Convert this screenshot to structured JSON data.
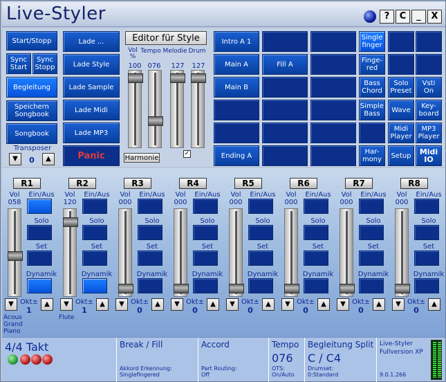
{
  "app": {
    "title": "Live-Styler"
  },
  "window": {
    "help": "?",
    "compact": "C",
    "minimize": "_",
    "close": "X"
  },
  "left_col": {
    "start": "Start/Stopp",
    "sync_start": "Sync Start",
    "sync_stop": "Sync Stopp",
    "begleitung": "Begleitung",
    "speichern": "Speichern Songbook",
    "songbook": "Songbook",
    "transposer_label": "Transposer",
    "transposer_value": "0"
  },
  "load_col": {
    "lade": "Lade ...",
    "style": "Lade Style",
    "sample": "Lade Sample",
    "midi": "Lade Midi",
    "mp3": "Lade MP3",
    "panic": "Panic"
  },
  "editor": {
    "button": "Editor für Style",
    "headers": [
      "Vol %",
      "Tempo",
      "Melodie",
      "Drum"
    ],
    "values": [
      "100",
      "076",
      "127",
      "127"
    ],
    "harmonie": "Harmonie"
  },
  "sections": {
    "intro": "Intro A 1",
    "main_a": "Main A",
    "main_b": "Main B",
    "fill_a": "Fill A",
    "ending": "Ending A"
  },
  "modes": {
    "single": "Single finger",
    "fingered": "Finge- red",
    "bass_chord": "Bass Chord",
    "simple_bass": "Simple Bass",
    "harmony": "Har- mony",
    "solo_preset": "Solo Preset",
    "vsti": "Vsti On",
    "wave": "Wave",
    "keyboard": "Key- board",
    "midi_player": "Midi Player",
    "mp3_player": "MP3 Player",
    "setup": "Setup",
    "midi_io": "Midi IO"
  },
  "channel_labels": {
    "vol": "Vol",
    "onoff": "Ein/Aus",
    "solo": "Solo",
    "set": "Set",
    "dynamik": "Dynamik",
    "okt": "Okt±"
  },
  "channels": [
    {
      "name": "R1",
      "vol": "058",
      "okt": "1",
      "instrument": "Acous Grand Piano",
      "level": 0.46,
      "on": true,
      "dyn": true
    },
    {
      "name": "R2",
      "vol": "120",
      "okt": "1",
      "instrument": "Flute",
      "level": 0.94,
      "on": false,
      "dyn": true
    },
    {
      "name": "R3",
      "vol": "000",
      "okt": "0",
      "instrument": "",
      "level": 0,
      "on": false,
      "dyn": false
    },
    {
      "name": "R4",
      "vol": "000",
      "okt": "0",
      "instrument": "",
      "level": 0,
      "on": false,
      "dyn": false
    },
    {
      "name": "R5",
      "vol": "000",
      "okt": "0",
      "instrument": "",
      "level": 0,
      "on": false,
      "dyn": false
    },
    {
      "name": "R6",
      "vol": "000",
      "okt": "0",
      "instrument": "",
      "level": 0,
      "on": false,
      "dyn": false
    },
    {
      "name": "R7",
      "vol": "000",
      "okt": "0",
      "instrument": "",
      "level": 0,
      "on": false,
      "dyn": false
    },
    {
      "name": "R8",
      "vol": "000",
      "okt": "0",
      "instrument": "",
      "level": 0,
      "on": false,
      "dyn": false
    }
  ],
  "status": {
    "takt": "4/4 Takt",
    "break_title": "Break / Fill",
    "break_sub1": "Akkord Erkennung:",
    "break_sub2": "Singlefingered",
    "accord_title": "Accord",
    "accord_sub1": "Part Routing:",
    "accord_sub2": "Off",
    "tempo_title": "Tempo",
    "tempo_value": "076",
    "tempo_sub1": "OTS:",
    "tempo_sub2": "On/Auto",
    "split_title": "Begleitung Split",
    "split_value": "C / C4",
    "split_sub1": "Drumset:",
    "split_sub2": "0:Standard",
    "version_title": "Live-Styler",
    "version_sub": "Fullversion XP",
    "version_num": "9.0.1.266"
  },
  "colors": {
    "led_green": "#2a9a3a",
    "led_red": "#b51d1d",
    "panic": "#e23a3a",
    "accent": "#0a3fa8"
  }
}
